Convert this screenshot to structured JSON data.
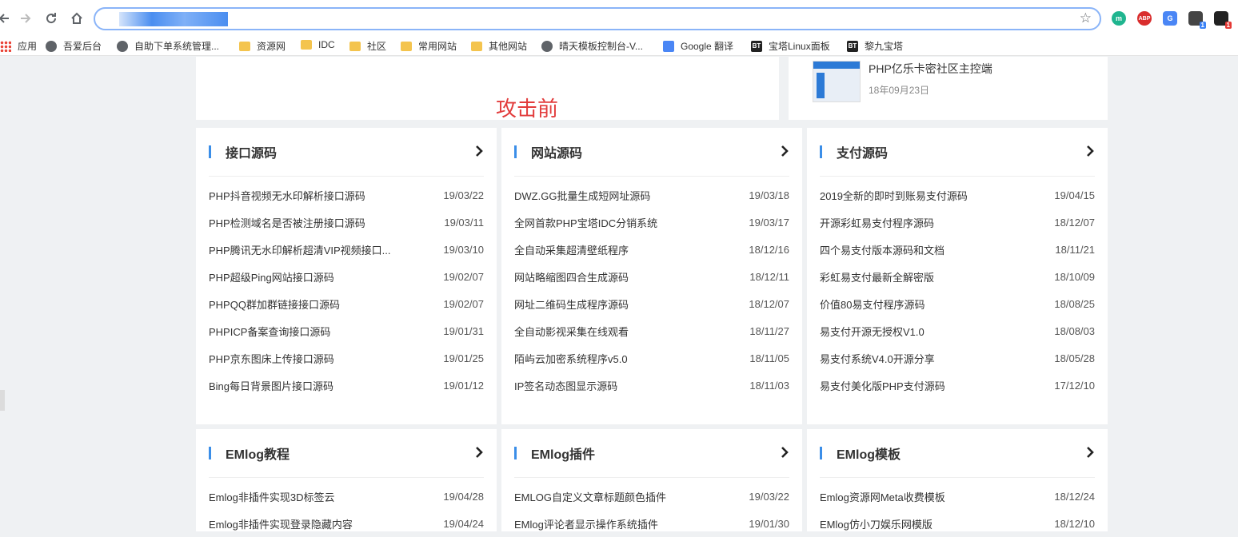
{
  "browser": {
    "bookmarks": [
      {
        "label": "应用",
        "icon": "apps-icon"
      },
      {
        "label": "吾爱后台",
        "icon": "globe-icon"
      },
      {
        "label": "自助下单系统管理...",
        "icon": "globe-icon"
      },
      {
        "label": "资源网",
        "icon": "folder-icon"
      },
      {
        "label": "IDC",
        "icon": "folder-icon"
      },
      {
        "label": "社区",
        "icon": "folder-icon"
      },
      {
        "label": "常用网站",
        "icon": "folder-icon"
      },
      {
        "label": "其他网站",
        "icon": "folder-icon"
      },
      {
        "label": "晴天模板控制台-V...",
        "icon": "globe-icon"
      },
      {
        "label": "Google 翻译",
        "icon": "google-translate-icon"
      },
      {
        "label": "宝塔Linux面板",
        "icon": "bt-icon"
      },
      {
        "label": "黎九宝塔",
        "icon": "bt-icon"
      }
    ],
    "extensions": {
      "abp": "ABP",
      "badge_one": "1",
      "badge_two": "1",
      "m": "m",
      "bt_icon_text": "BT"
    }
  },
  "page": {
    "caption": "攻击前",
    "featured": {
      "title": "PHP亿乐卡密社区主控端",
      "date": "18年09月23日"
    },
    "cards": [
      {
        "title": "接口源码",
        "items": [
          {
            "name": "PHP抖音视频无水印解析接口源码",
            "date": "19/03/22"
          },
          {
            "name": "PHP检测域名是否被注册接口源码",
            "date": "19/03/11"
          },
          {
            "name": "PHP腾讯无水印解析超清VIP视频接口...",
            "date": "19/03/10"
          },
          {
            "name": "PHP超级Ping网站接口源码",
            "date": "19/02/07"
          },
          {
            "name": "PHPQQ群加群链接接口源码",
            "date": "19/02/07"
          },
          {
            "name": "PHPICP备案查询接口源码",
            "date": "19/01/31"
          },
          {
            "name": "PHP京东图床上传接口源码",
            "date": "19/01/25"
          },
          {
            "name": "Bing每日背景图片接口源码",
            "date": "19/01/12"
          }
        ]
      },
      {
        "title": "网站源码",
        "items": [
          {
            "name": "DWZ.GG批量生成短网址源码",
            "date": "19/03/18"
          },
          {
            "name": "全网首款PHP宝塔IDC分销系统",
            "date": "19/03/17"
          },
          {
            "name": "全自动采集超清壁纸程序",
            "date": "18/12/16"
          },
          {
            "name": "网站略缩图四合生成源码",
            "date": "18/12/11"
          },
          {
            "name": "网址二维码生成程序源码",
            "date": "18/12/07"
          },
          {
            "name": "全自动影视采集在线观看",
            "date": "18/11/27"
          },
          {
            "name": "陌屿云加密系统程序v5.0",
            "date": "18/11/05"
          },
          {
            "name": "IP签名动态图显示源码",
            "date": "18/11/03"
          }
        ]
      },
      {
        "title": "支付源码",
        "items": [
          {
            "name": "2019全新的即时到账易支付源码",
            "date": "19/04/15"
          },
          {
            "name": "开源彩虹易支付程序源码",
            "date": "18/12/07"
          },
          {
            "name": "四个易支付版本源码和文档",
            "date": "18/11/21"
          },
          {
            "name": "彩虹易支付最新全解密版",
            "date": "18/10/09"
          },
          {
            "name": "价值80易支付程序源码",
            "date": "18/08/25"
          },
          {
            "name": "易支付开源无授权V1.0",
            "date": "18/08/03"
          },
          {
            "name": "易支付系统V4.0开源分享",
            "date": "18/05/28"
          },
          {
            "name": "易支付美化版PHP支付源码",
            "date": "17/12/10"
          }
        ]
      },
      {
        "title": "EMlog教程",
        "items": [
          {
            "name": "Emlog非插件实现3D标签云",
            "date": "19/04/28"
          },
          {
            "name": "Emlog非插件实现登录隐藏内容",
            "date": "19/04/24"
          }
        ]
      },
      {
        "title": "EMlog插件",
        "items": [
          {
            "name": "EMLOG自定义文章标题颜色插件",
            "date": "19/03/22"
          },
          {
            "name": "EMlog评论者显示操作系统插件",
            "date": "19/01/30"
          }
        ]
      },
      {
        "title": "EMlog模板",
        "items": [
          {
            "name": "Emlog资源网Meta收费模板",
            "date": "18/12/24"
          },
          {
            "name": "EMlog仿小刀娱乐网模版",
            "date": "18/12/10"
          }
        ]
      }
    ]
  }
}
